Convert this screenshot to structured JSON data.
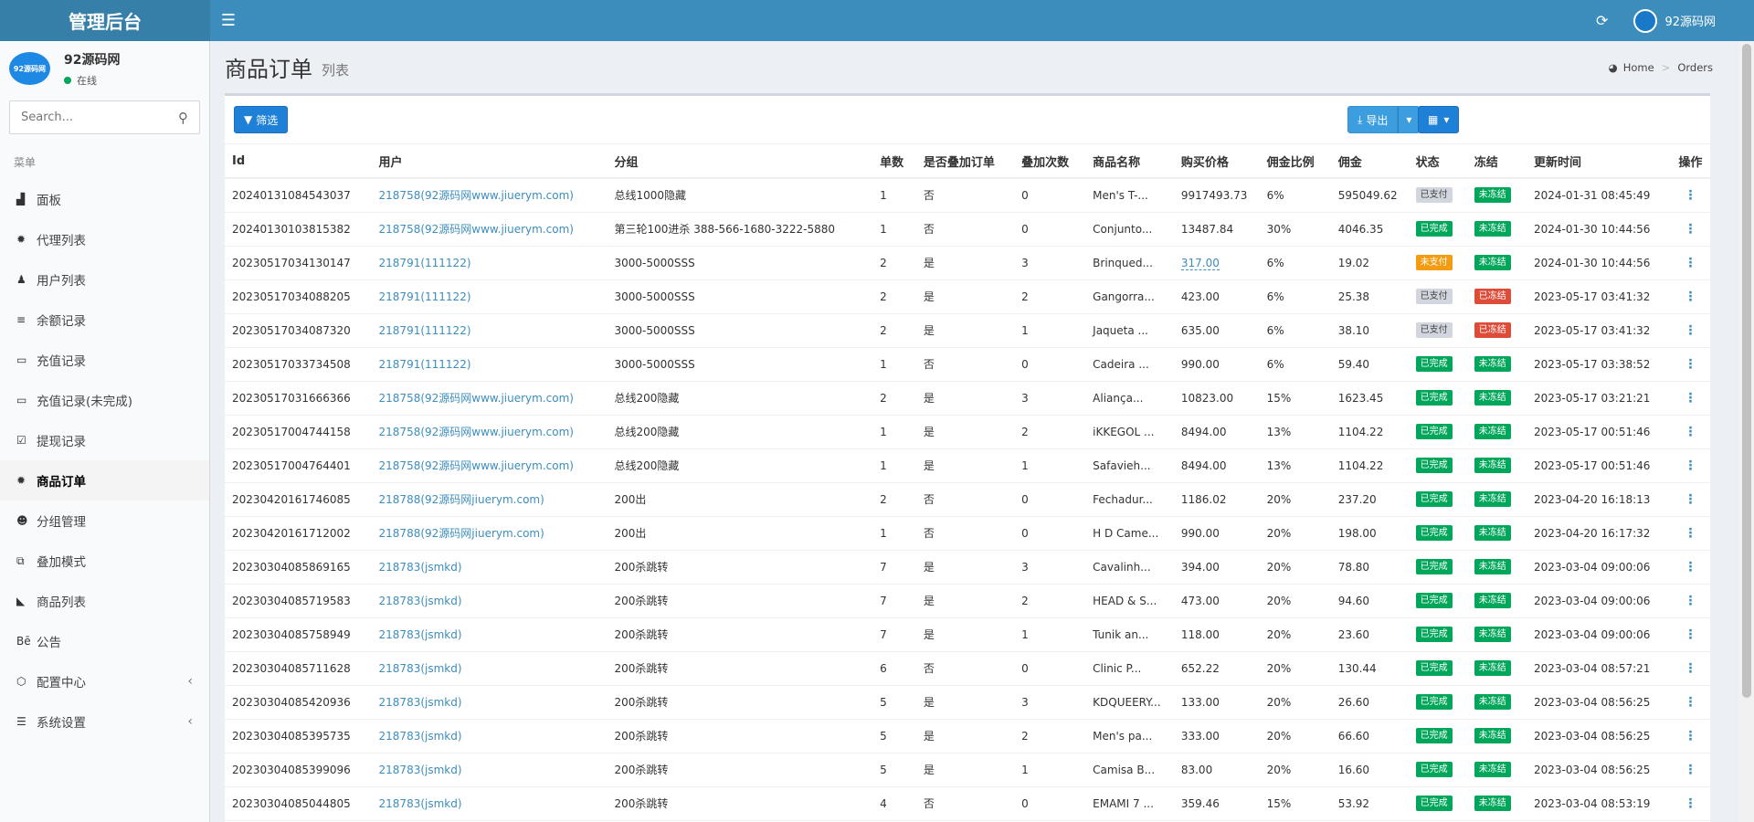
{
  "header": {
    "logo": "管理后台",
    "toggle_icon": "☰",
    "refresh_icon": "⟳",
    "user_name": "92源码网"
  },
  "sidebar": {
    "avatar_text": "92源码网",
    "user_name": "92源码网",
    "status": "在线",
    "search_placeholder": "Search...",
    "menu_header": "菜单",
    "items": [
      {
        "icon": "▟",
        "label": "面板"
      },
      {
        "icon": "✹",
        "label": "代理列表"
      },
      {
        "icon": "♟",
        "label": "用户列表"
      },
      {
        "icon": "≡",
        "label": "余额记录"
      },
      {
        "icon": "▭",
        "label": "充值记录"
      },
      {
        "icon": "▭",
        "label": "充值记录(未完成)"
      },
      {
        "icon": "☑",
        "label": "提现记录"
      },
      {
        "icon": "✹",
        "label": "商品订单"
      },
      {
        "icon": "☻",
        "label": "分组管理"
      },
      {
        "icon": "⧉",
        "label": "叠加模式"
      },
      {
        "icon": "◣",
        "label": "商品列表"
      },
      {
        "icon": "Bē",
        "label": "公告"
      },
      {
        "icon": "⬡",
        "label": "配置中心"
      },
      {
        "icon": "☰",
        "label": "系统设置"
      }
    ]
  },
  "content": {
    "title": "商品订单",
    "subtitle": "列表",
    "breadcrumb": [
      "Home",
      "Orders"
    ]
  },
  "toolbar": {
    "filter_label": "筛选",
    "export_label": "导出"
  },
  "table": {
    "columns": [
      "Id",
      "用户",
      "分组",
      "单数",
      "是否叠加订单",
      "叠加次数",
      "商品名称",
      "购买价格",
      "佣金比例",
      "佣金",
      "状态",
      "冻结",
      "更新时间",
      "操作"
    ],
    "rows": [
      [
        "20240131084543037",
        "218758(92源码网www.jiuerym.com)",
        "总线1000隐藏",
        "1",
        "否",
        "0",
        "Men's T-...",
        "9917493.73",
        "6%",
        "595049.62",
        "已支付",
        "未冻结",
        "2024-01-31 08:45:49"
      ],
      [
        "20240130103815382",
        "218758(92源码网www.jiuerym.com)",
        "第三轮100进杀 388-566-1680-3222-5880",
        "1",
        "否",
        "0",
        "Conjunto...",
        "13487.84",
        "30%",
        "4046.35",
        "已完成",
        "未冻结",
        "2024-01-30 10:44:56"
      ],
      [
        "20230517034130147",
        "218791(111122)",
        "3000-5000SSS",
        "2",
        "是",
        "3",
        "Brinqued...",
        "317.00",
        "6%",
        "19.02",
        "未支付",
        "未冻结",
        "2024-01-30 10:44:56"
      ],
      [
        "20230517034088205",
        "218791(111122)",
        "3000-5000SSS",
        "2",
        "是",
        "2",
        "Gangorra...",
        "423.00",
        "6%",
        "25.38",
        "已支付",
        "已冻结",
        "2023-05-17 03:41:32"
      ],
      [
        "20230517034087320",
        "218791(111122)",
        "3000-5000SSS",
        "2",
        "是",
        "1",
        "Jaqueta ...",
        "635.00",
        "6%",
        "38.10",
        "已支付",
        "已冻结",
        "2023-05-17 03:41:32"
      ],
      [
        "20230517033734508",
        "218791(111122)",
        "3000-5000SSS",
        "1",
        "否",
        "0",
        "Cadeira ...",
        "990.00",
        "6%",
        "59.40",
        "已完成",
        "未冻结",
        "2023-05-17 03:38:52"
      ],
      [
        "20230517031666366",
        "218758(92源码网www.jiuerym.com)",
        "总线200隐藏",
        "2",
        "是",
        "3",
        "Aliança...",
        "10823.00",
        "15%",
        "1623.45",
        "已完成",
        "未冻结",
        "2023-05-17 03:21:21"
      ],
      [
        "20230517004744158",
        "218758(92源码网www.jiuerym.com)",
        "总线200隐藏",
        "1",
        "是",
        "2",
        "iKKEGOL ...",
        "8494.00",
        "13%",
        "1104.22",
        "已完成",
        "未冻结",
        "2023-05-17 00:51:46"
      ],
      [
        "20230517004764401",
        "218758(92源码网www.jiuerym.com)",
        "总线200隐藏",
        "1",
        "是",
        "1",
        "Safavieh...",
        "8494.00",
        "13%",
        "1104.22",
        "已完成",
        "未冻结",
        "2023-05-17 00:51:46"
      ],
      [
        "20230420161746085",
        "218788(92源码网jiuerym.com)",
        "200出",
        "2",
        "否",
        "0",
        "Fechadur...",
        "1186.02",
        "20%",
        "237.20",
        "已完成",
        "未冻结",
        "2023-04-20 16:18:13"
      ],
      [
        "20230420161712002",
        "218788(92源码网jiuerym.com)",
        "200出",
        "1",
        "否",
        "0",
        "H D Came...",
        "990.00",
        "20%",
        "198.00",
        "已完成",
        "未冻结",
        "2023-04-20 16:17:32"
      ],
      [
        "20230304085869165",
        "218783(jsmkd)",
        "200杀跳转",
        "7",
        "是",
        "3",
        "Cavalinh...",
        "394.00",
        "20%",
        "78.80",
        "已完成",
        "未冻结",
        "2023-03-04 09:00:06"
      ],
      [
        "20230304085719583",
        "218783(jsmkd)",
        "200杀跳转",
        "7",
        "是",
        "2",
        "HEAD & S...",
        "473.00",
        "20%",
        "94.60",
        "已完成",
        "未冻结",
        "2023-03-04 09:00:06"
      ],
      [
        "20230304085758949",
        "218783(jsmkd)",
        "200杀跳转",
        "7",
        "是",
        "1",
        "Tunik an...",
        "118.00",
        "20%",
        "23.60",
        "已完成",
        "未冻结",
        "2023-03-04 09:00:06"
      ],
      [
        "20230304085711628",
        "218783(jsmkd)",
        "200杀跳转",
        "6",
        "否",
        "0",
        "Clinic P...",
        "652.22",
        "20%",
        "130.44",
        "已完成",
        "未冻结",
        "2023-03-04 08:57:21"
      ],
      [
        "20230304085420936",
        "218783(jsmkd)",
        "200杀跳转",
        "5",
        "是",
        "3",
        "KDQUEERY...",
        "133.00",
        "20%",
        "26.60",
        "已完成",
        "未冻结",
        "2023-03-04 08:56:25"
      ],
      [
        "20230304085395735",
        "218783(jsmkd)",
        "200杀跳转",
        "5",
        "是",
        "2",
        "Men's pa...",
        "333.00",
        "20%",
        "66.60",
        "已完成",
        "未冻结",
        "2023-03-04 08:56:25"
      ],
      [
        "20230304085399096",
        "218783(jsmkd)",
        "200杀跳转",
        "5",
        "是",
        "1",
        "Camisa B...",
        "83.00",
        "20%",
        "16.60",
        "已完成",
        "未冻结",
        "2023-03-04 08:56:25"
      ],
      [
        "20230304085044805",
        "218783(jsmkd)",
        "200杀跳转",
        "4",
        "否",
        "0",
        "EMAMI 7 ...",
        "359.46",
        "15%",
        "53.92",
        "已完成",
        "未冻结",
        "2023-03-04 08:53:19"
      ]
    ]
  }
}
